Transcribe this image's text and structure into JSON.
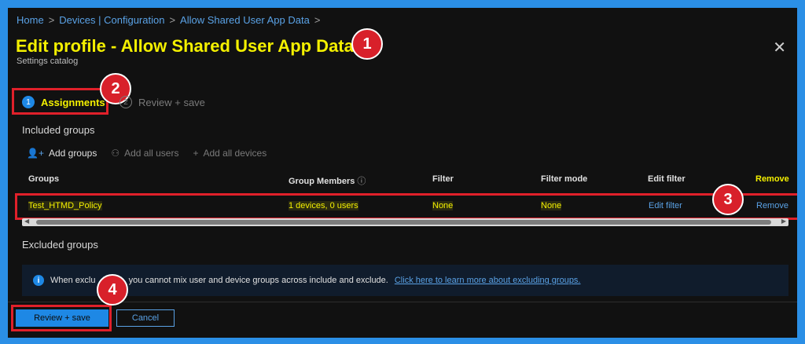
{
  "breadcrumb": [
    "Home",
    "Devices | Configuration",
    "Allow Shared User App Data"
  ],
  "breadcrumb_separator": ">",
  "header": {
    "title": "Edit profile - Allow Shared User App Data",
    "subtitle": "Settings catalog",
    "close_icon": "✕"
  },
  "tabs": [
    {
      "number": "1",
      "label": "Assignments",
      "active": true
    },
    {
      "number": "2",
      "label": "Review + save",
      "active": false
    }
  ],
  "included": {
    "heading": "Included groups",
    "actions": [
      {
        "icon": "add-user-icon",
        "glyph": "👤+",
        "label": "Add groups",
        "enabled": true
      },
      {
        "icon": "add-all-users-icon",
        "glyph": "⚇",
        "label": "Add all users",
        "enabled": false
      },
      {
        "icon": "plus-icon",
        "glyph": "+",
        "label": "Add all devices",
        "enabled": false
      }
    ],
    "columns": [
      "Groups",
      "Group Members",
      "Filter",
      "Filter mode",
      "Edit filter",
      "Remove"
    ],
    "info_icon": "ⓘ",
    "rows": [
      {
        "group": "Test_HTMD_Policy",
        "members": "1 devices, 0 users",
        "filter": "None",
        "filter_mode": "None",
        "edit_filter": "Edit filter",
        "remove": "Remove"
      }
    ]
  },
  "excluded": {
    "heading": "Excluded groups",
    "info_text": "When exclu      ups, you cannot mix user and device groups across include and exclude.",
    "info_link": "Click here to learn more about excluding groups."
  },
  "footer": {
    "primary_label": "Review + save",
    "cancel_label": "Cancel"
  },
  "callouts": [
    "1",
    "2",
    "3",
    "4"
  ],
  "colors": {
    "background": "#111111",
    "frame": "#2b8fe6",
    "highlight_text": "#f4f000",
    "accent": "#1e88e5",
    "link": "#5aa2e6",
    "callout": "#d8202a"
  }
}
